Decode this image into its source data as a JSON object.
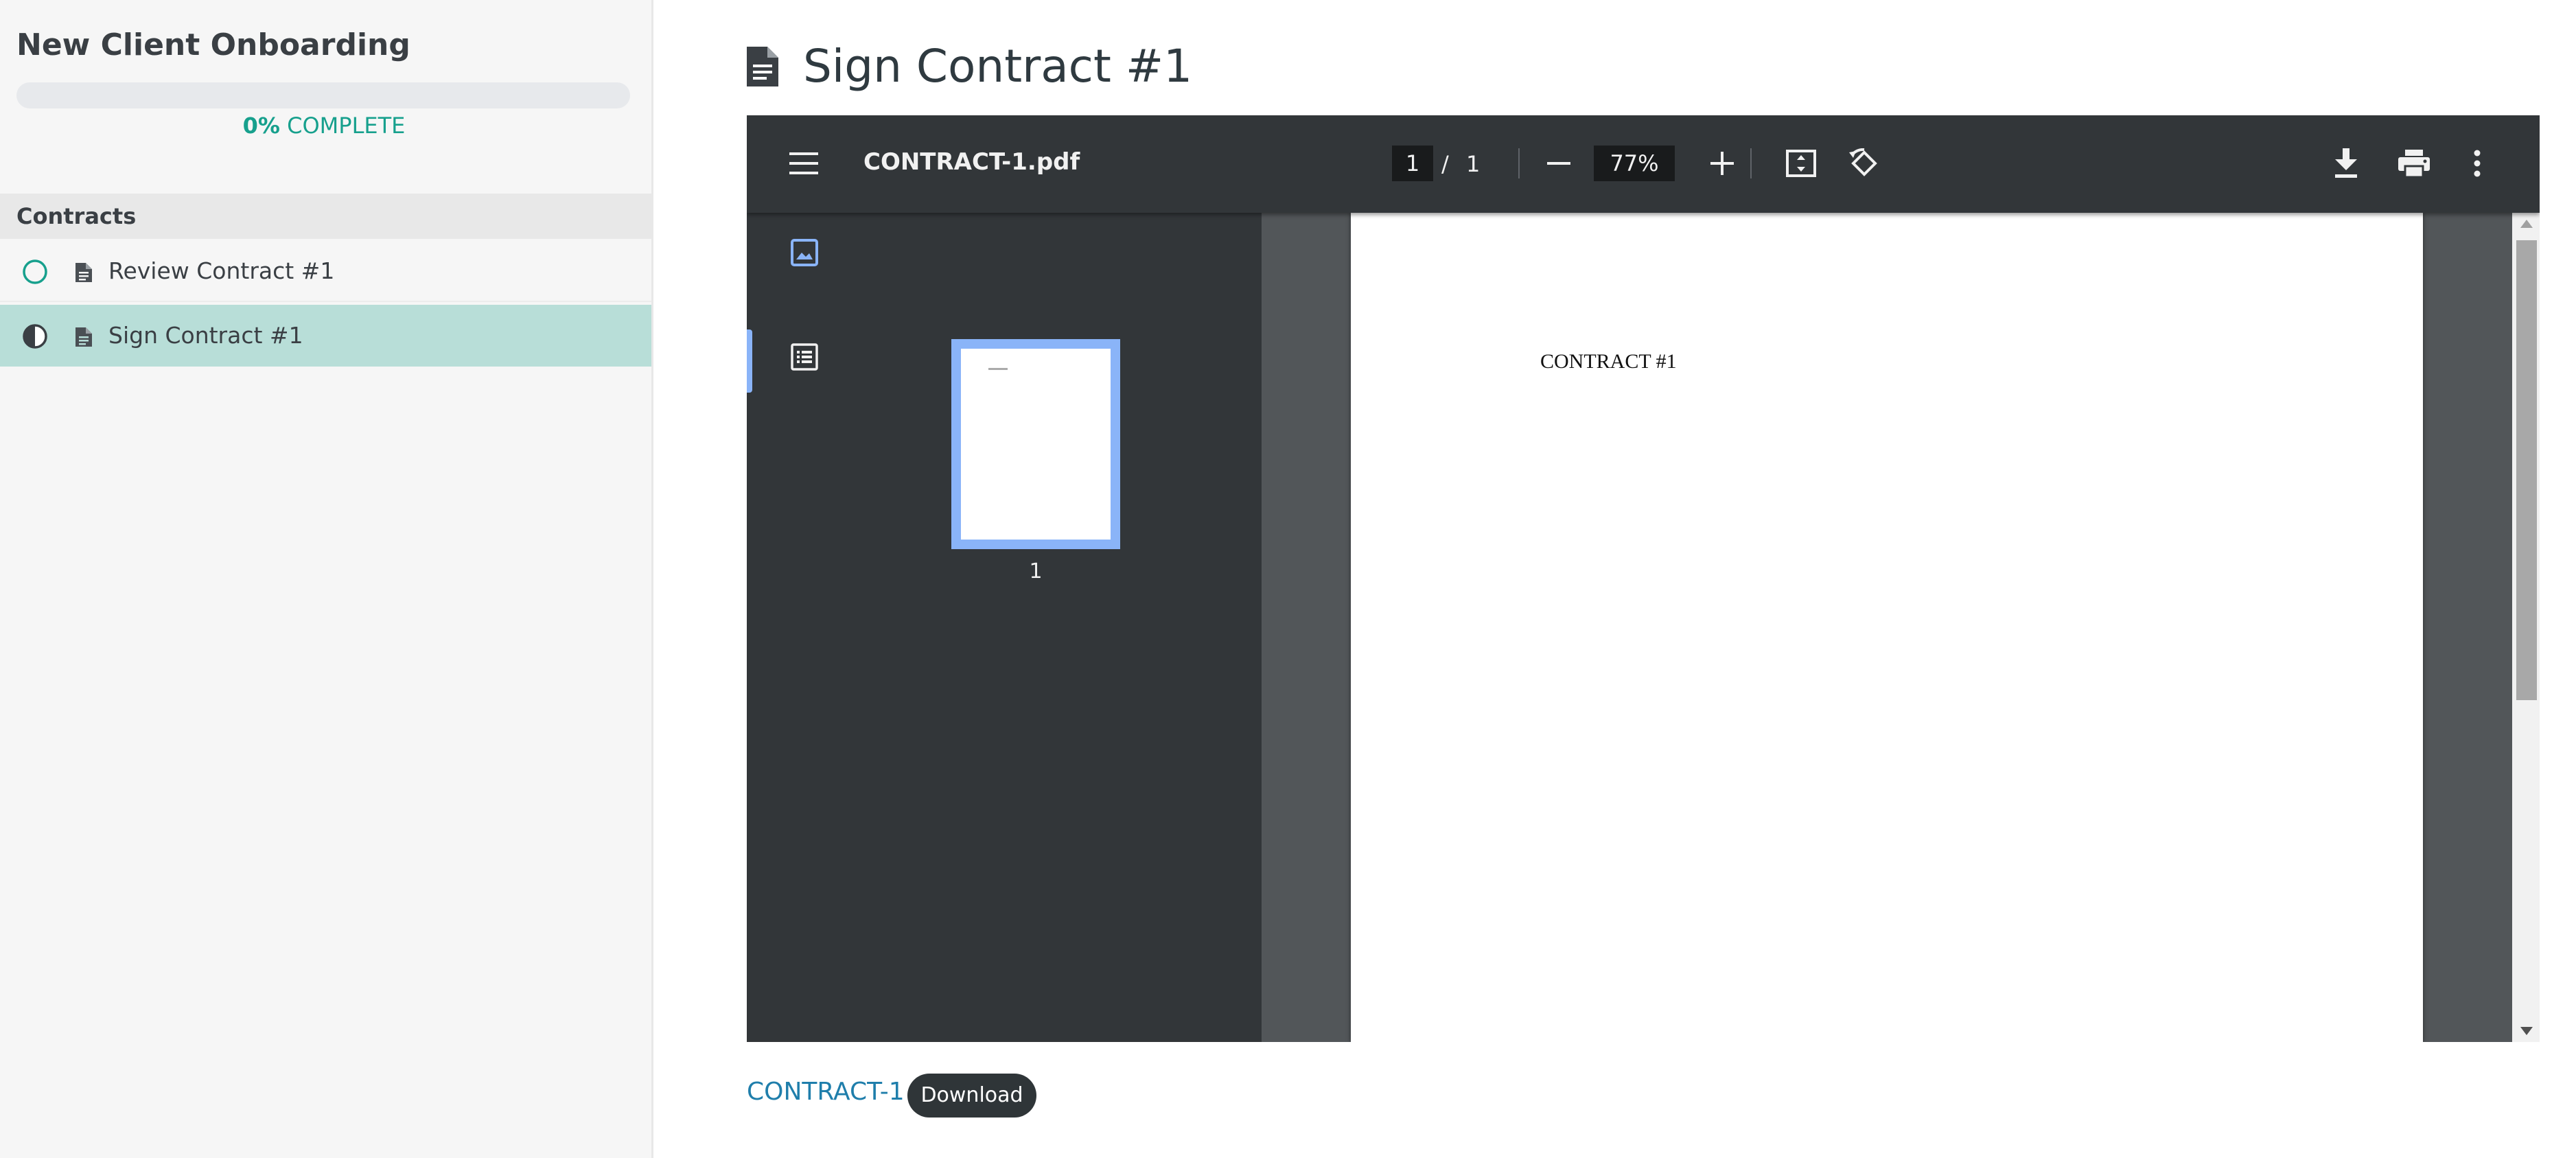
{
  "sidebar": {
    "title": "New Client Onboarding",
    "progress": {
      "percent": 0,
      "percent_label": "0%",
      "suffix": "COMPLETE"
    },
    "section": "Contracts",
    "items": [
      {
        "label": "Review Contract #1",
        "status": "not-started"
      },
      {
        "label": "Sign Contract #1",
        "status": "in-progress",
        "active": true
      }
    ]
  },
  "main": {
    "title": "Sign Contract #1",
    "viewer": {
      "filename": "CONTRACT-1.pdf",
      "current_page": "1",
      "page_separator": "/",
      "total_pages": "1",
      "zoom": "77%",
      "thumbnail_label": "1",
      "document_text": "CONTRACT #1"
    },
    "attachment": {
      "name": "CONTRACT-1",
      "download_label": "Download"
    }
  },
  "colors": {
    "accent": "#17a08d",
    "active_row": "#b8ded8",
    "link": "#1f7eab",
    "viewer_toolbar": "#323639",
    "thumb_highlight": "#8ab4f8"
  }
}
